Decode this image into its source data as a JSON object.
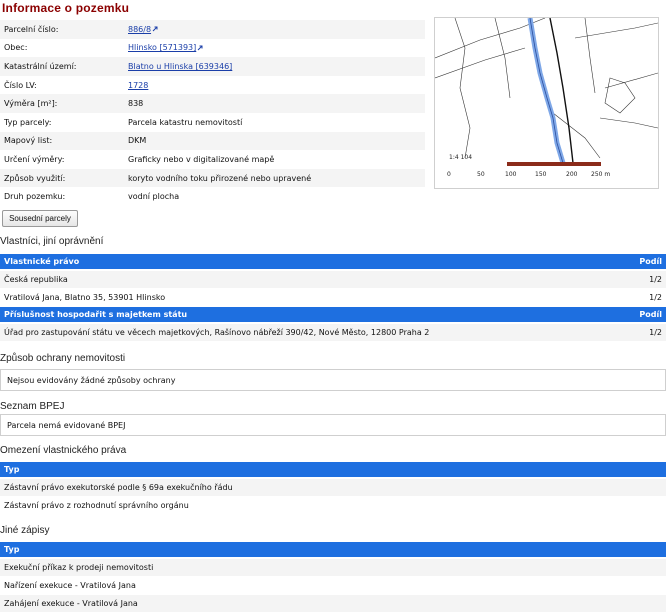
{
  "page_title": "Informace o pozemku",
  "parcel_info": [
    {
      "label": "Parcelní číslo:",
      "value": "886/8",
      "link": true
    },
    {
      "label": "Obec:",
      "value": "Hlinsko [571393]",
      "link": true
    },
    {
      "label": "Katastrální území:",
      "value": "Blatno u Hlinska [639346]",
      "link": true
    },
    {
      "label": "Číslo LV:",
      "value": "1728",
      "link": true
    },
    {
      "label": "Výměra [m²]:",
      "value": "838",
      "link": false
    },
    {
      "label": "Typ parcely:",
      "value": "Parcela katastru nemovitostí",
      "link": false
    },
    {
      "label": "Mapový list:",
      "value": "DKM",
      "link": false
    },
    {
      "label": "Určení výměry:",
      "value": "Graficky nebo v digitalizované mapě",
      "link": false
    },
    {
      "label": "Způsob využití:",
      "value": "koryto vodního toku přirozené nebo upravené",
      "link": false
    },
    {
      "label": "Druh pozemku:",
      "value": "vodní plocha",
      "link": false
    }
  ],
  "map": {
    "scale_label": "1:4 104",
    "scale_ticks": [
      "0",
      "50",
      "100",
      "150",
      "200",
      "250 m"
    ]
  },
  "neighbors_button": "Sousední parcely",
  "owners": {
    "heading": "Vlastníci, jiní oprávnění",
    "ownership": {
      "col_type": "Vlastnické právo",
      "col_share": "Podíl",
      "rows": [
        {
          "name": "Česká republika",
          "share": "1/2"
        },
        {
          "name": "Vratilová Jana, Blatno 35, 53901 Hlinsko",
          "share": "1/2"
        }
      ]
    },
    "management": {
      "col_type": "Příslušnost hospodařit s majetkem státu",
      "col_share": "Podíl",
      "rows": [
        {
          "name": "Úřad pro zastupování státu ve věcech majetkových, Rašínovo nábřeží 390/42, Nové Město, 12800 Praha 2",
          "share": "1/2"
        }
      ]
    }
  },
  "protection": {
    "heading": "Způsob ochrany nemovitosti",
    "text": "Nejsou evidovány žádné způsoby ochrany"
  },
  "bpej": {
    "heading": "Seznam BPEJ",
    "text": "Parcela nemá evidované BPEJ"
  },
  "restrictions": {
    "heading": "Omezení vlastnického práva",
    "col_type": "Typ",
    "rows": [
      "Zástavní právo exekutorské podle § 69a exekučního řádu",
      "Zástavní právo z rozhodnutí správního orgánu"
    ]
  },
  "other_records": {
    "heading": "Jiné zápisy",
    "col_type": "Typ",
    "rows": [
      "Exekuční příkaz k prodeji nemovitosti",
      "Nařízení exekuce - Vratilová Jana",
      "Zahájení exekuce - Vratilová Jana"
    ]
  },
  "colors": {
    "title": "#8b0000",
    "header_bg": "#1e6fe0",
    "link": "#1a3ea8",
    "river": "#7fa8e8",
    "scale_bar": "#8b2b1a"
  }
}
